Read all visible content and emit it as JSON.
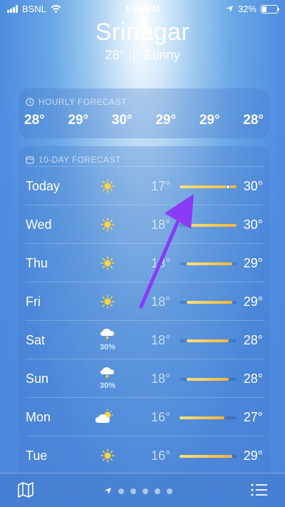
{
  "status": {
    "carrier": "BSNL",
    "time": "1:06 PM",
    "battery": "32%",
    "battery_level": 0.32
  },
  "location": {
    "city": "Srinagar",
    "temp": "28°",
    "separator": "|",
    "condition": "Sunny"
  },
  "hourly": {
    "label": "HOURLY FORECAST",
    "temps": [
      "28°",
      "29°",
      "30°",
      "29°",
      "29°",
      "28°"
    ]
  },
  "daily": {
    "label": "10-DAY FORECAST",
    "days": [
      {
        "day": "Today",
        "icon": "sun-icon",
        "low": "17°",
        "high": "30°",
        "range": [
          0.0,
          1.0
        ],
        "current": 0.85
      },
      {
        "day": "Wed",
        "icon": "sun-icon",
        "low": "18°",
        "high": "30°",
        "range": [
          0.12,
          1.0
        ]
      },
      {
        "day": "Thu",
        "icon": "sun-icon",
        "low": "18°",
        "high": "29°",
        "range": [
          0.12,
          0.93
        ]
      },
      {
        "day": "Fri",
        "icon": "sun-icon",
        "low": "18°",
        "high": "29°",
        "range": [
          0.12,
          0.93
        ]
      },
      {
        "day": "Sat",
        "icon": "thunderstorm-icon",
        "precip": "30%",
        "low": "18°",
        "high": "28°",
        "range": [
          0.12,
          0.86
        ]
      },
      {
        "day": "Sun",
        "icon": "thunderstorm-icon",
        "precip": "30%",
        "low": "18°",
        "high": "28°",
        "range": [
          0.12,
          0.86
        ]
      },
      {
        "day": "Mon",
        "icon": "partly-cloudy-icon",
        "low": "16°",
        "high": "27°",
        "range": [
          0.0,
          0.79
        ]
      },
      {
        "day": "Tue",
        "icon": "sun-icon",
        "low": "16°",
        "high": "29°",
        "range": [
          0.0,
          0.93
        ]
      }
    ]
  },
  "pager": {
    "page_count": 5,
    "current_index": 0
  },
  "colors": {
    "accent_arrow": "#8a3bf5",
    "bar_start": "#ffe27a",
    "bar_end": "#f4b43c"
  }
}
